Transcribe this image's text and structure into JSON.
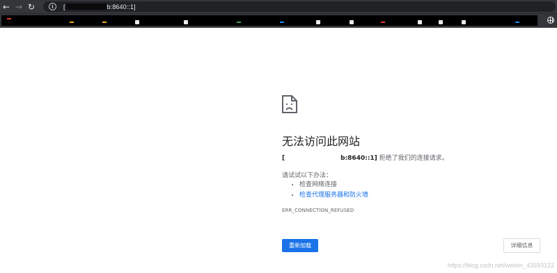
{
  "browser": {
    "url_visible_tail": "b:8640::1]",
    "url_visible_head": "["
  },
  "bookmarks": {
    "accent_colors": [
      "#e53935",
      "#f9a825",
      "#f9a825",
      "#43a047",
      "#e53935",
      "#1e88e5",
      "#e53935",
      "#fdd835",
      "#1e88e5"
    ]
  },
  "error": {
    "title": "无法访问此网站",
    "host_visible_head": "[",
    "host_visible_tail": "b:8640::1]",
    "message": " 拒绝了我们的连接请求。",
    "try_label": "请试试以下办法：",
    "suggestions": [
      {
        "text": "检查网络连接",
        "link": false
      },
      {
        "text": "检查代理服务器和防火墙",
        "link": true
      }
    ],
    "code": "ERR_CONNECTION_REFUSED"
  },
  "buttons": {
    "reload": "重新加载",
    "details": "详细信息"
  },
  "watermark": "https://blog.csdn.net/weixin_43593122",
  "colors": {
    "chrome_bg": "#35363a",
    "link_blue": "#1a73e8",
    "text_gray": "#5f6368"
  }
}
